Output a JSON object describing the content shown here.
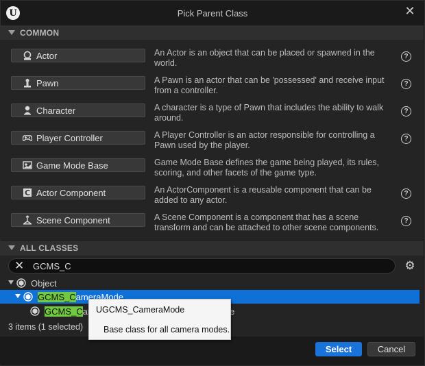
{
  "window": {
    "title": "Pick Parent Class"
  },
  "common": {
    "header": "COMMON",
    "items": [
      {
        "label": "Actor",
        "icon": "actor-icon",
        "description": "An Actor is an object that can be placed or spawned in the world."
      },
      {
        "label": "Pawn",
        "icon": "pawn-icon",
        "description": "A Pawn is an actor that can be 'possessed' and receive input from a controller."
      },
      {
        "label": "Character",
        "icon": "character-icon",
        "description": "A character is a type of Pawn that includes the ability to walk around."
      },
      {
        "label": "Player Controller",
        "icon": "gamepad-icon",
        "description": "A Player Controller is an actor responsible for controlling a Pawn used by the player."
      },
      {
        "label": "Game Mode Base",
        "icon": "game-mode-icon",
        "description": "Game Mode Base defines the game being played, its rules, scoring, and other facets of the game type."
      },
      {
        "label": "Actor Component",
        "icon": "actor-component-icon",
        "description": "An ActorComponent is a reusable component that can be added to any actor."
      },
      {
        "label": "Scene Component",
        "icon": "scene-component-icon",
        "description": "A Scene Component is a component that has a scene transform and can be attached to other scene components."
      }
    ]
  },
  "all_classes": {
    "header": "ALL CLASSES",
    "search": {
      "value": "GCMS_C"
    },
    "tree": {
      "root": "Object",
      "selected": {
        "match": "GCMS_C",
        "rest": "ameraMode"
      },
      "child": {
        "match": "GCMS_C",
        "rest_start": "ar",
        "rest_end": "e"
      }
    },
    "count": "3 items (1 selected)"
  },
  "tooltip": {
    "title": "UGCMS_CameraMode",
    "description": "Base class for all camera modes."
  },
  "buttons": {
    "select": "Select",
    "cancel": "Cancel"
  },
  "colors": {
    "accent": "#1a73d9",
    "highlight": "#70c93e",
    "selection": "#0f70d8"
  }
}
